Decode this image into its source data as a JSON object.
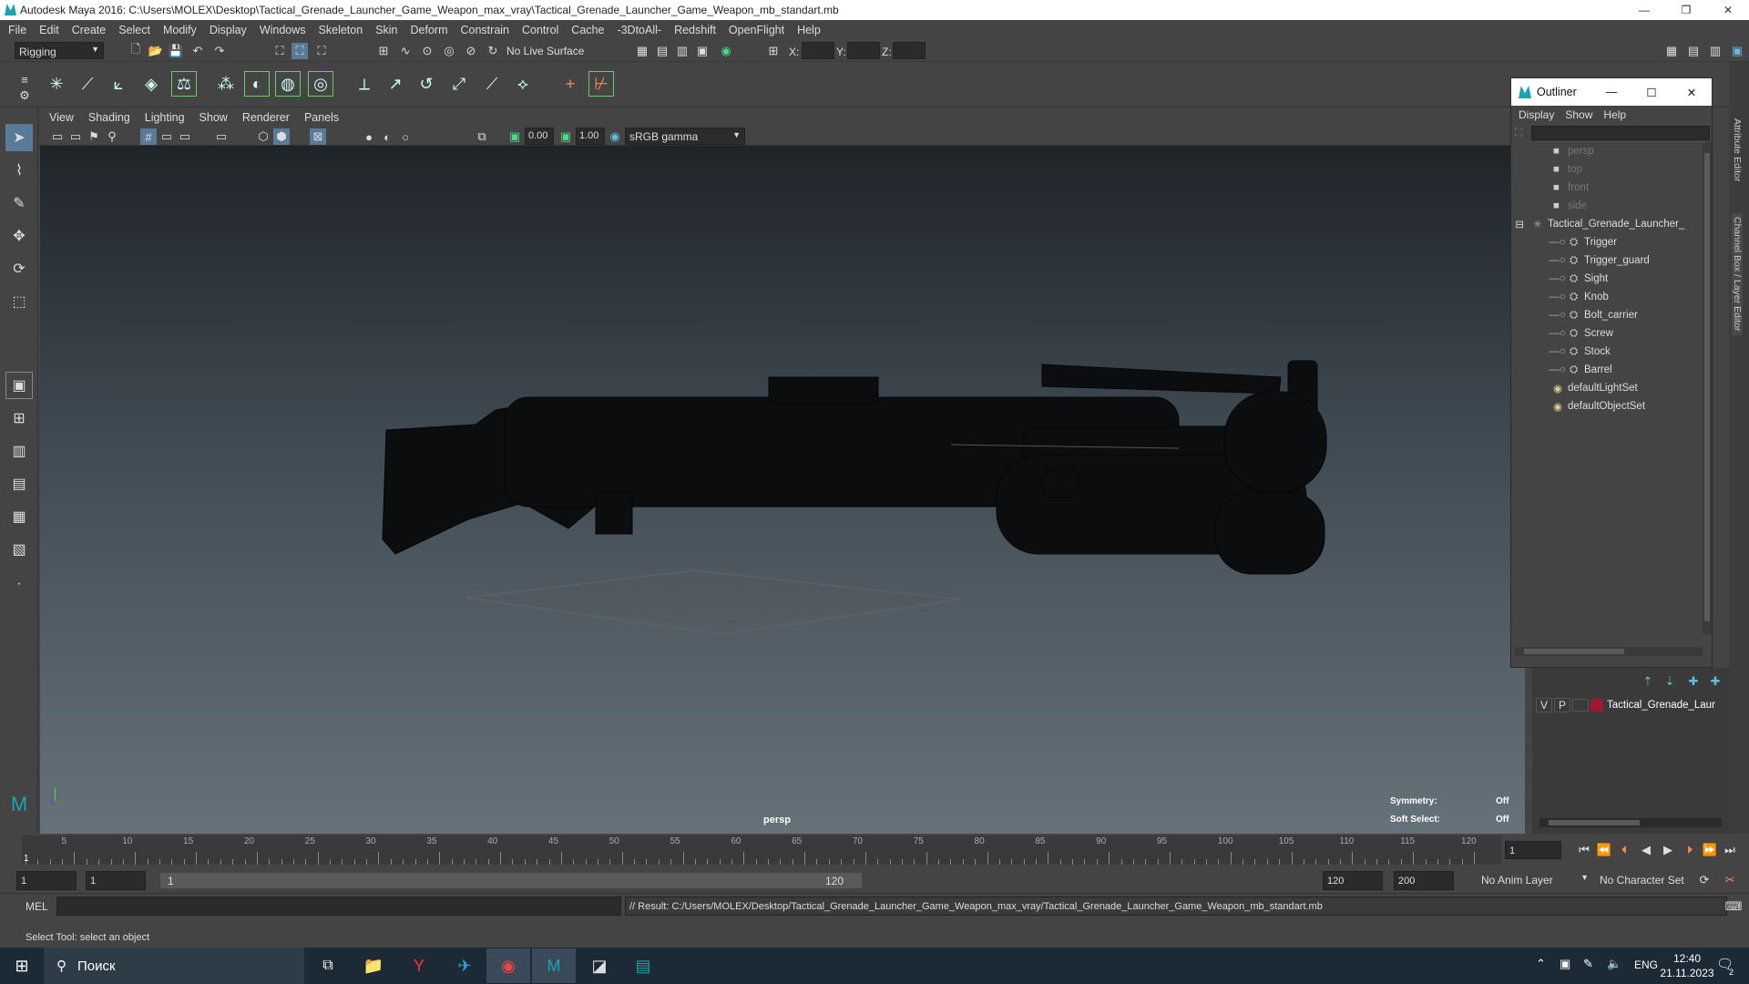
{
  "window": {
    "title": "Autodesk Maya 2016: C:\\Users\\MOLEX\\Desktop\\Tactical_Grenade_Launcher_Game_Weapon_max_vray\\Tactical_Grenade_Launcher_Game_Weapon_mb_standart.mb",
    "minimize": "—",
    "restore": "❐",
    "close": "✕"
  },
  "menubar": [
    "File",
    "Edit",
    "Create",
    "Select",
    "Modify",
    "Display",
    "Windows",
    "Skeleton",
    "Skin",
    "Deform",
    "Constrain",
    "Control",
    "Cache",
    "-3DtoAll-",
    "Redshift",
    "OpenFlight",
    "Help"
  ],
  "status": {
    "mode": "Rigging",
    "live_surface": "No Live Surface",
    "x_label": "X:",
    "y_label": "Y:",
    "z_label": "Z:"
  },
  "panel_menu": [
    "View",
    "Shading",
    "Lighting",
    "Show",
    "Renderer",
    "Panels"
  ],
  "panel_toolbar": {
    "exposure": "0.00",
    "gamma": "1.00",
    "color_space": "sRGB gamma"
  },
  "viewport": {
    "camera_label": "persp",
    "symmetry_label": "Symmetry:",
    "symmetry_value": "Off",
    "soft_select_label": "Soft Select:",
    "soft_select_value": "Off"
  },
  "outliner": {
    "title": "Outliner",
    "menu": [
      "Display",
      "Show",
      "Help"
    ],
    "items": [
      {
        "label": "persp",
        "kind": "camera",
        "indent": 0,
        "dim": true
      },
      {
        "label": "top",
        "kind": "camera",
        "indent": 0,
        "dim": true
      },
      {
        "label": "front",
        "kind": "camera",
        "indent": 0,
        "dim": true
      },
      {
        "label": "side",
        "kind": "camera",
        "indent": 0,
        "dim": true
      },
      {
        "label": "Tactical_Grenade_Launcher_",
        "kind": "group",
        "indent": 0,
        "dim": false
      },
      {
        "label": "Trigger",
        "kind": "mesh",
        "indent": 1,
        "dim": false
      },
      {
        "label": "Trigger_guard",
        "kind": "mesh",
        "indent": 1,
        "dim": false
      },
      {
        "label": "Sight",
        "kind": "mesh",
        "indent": 1,
        "dim": false
      },
      {
        "label": "Knob",
        "kind": "mesh",
        "indent": 1,
        "dim": false
      },
      {
        "label": "Bolt_carrier",
        "kind": "mesh",
        "indent": 1,
        "dim": false
      },
      {
        "label": "Screw",
        "kind": "mesh",
        "indent": 1,
        "dim": false
      },
      {
        "label": "Stock",
        "kind": "mesh",
        "indent": 1,
        "dim": false
      },
      {
        "label": "Barrel",
        "kind": "mesh",
        "indent": 1,
        "dim": false
      },
      {
        "label": "defaultLightSet",
        "kind": "set",
        "indent": 0,
        "dim": false
      },
      {
        "label": "defaultObjectSet",
        "kind": "set",
        "indent": 0,
        "dim": false
      }
    ]
  },
  "side_tabs": [
    "Attribute Editor",
    "Channel Box / Layer Editor"
  ],
  "layer": {
    "v": "V",
    "p": "P",
    "name": "Tactical_Grenade_Laur",
    "color": "#a01830"
  },
  "timeline": {
    "ticks": [
      "5",
      "10",
      "15",
      "20",
      "25",
      "30",
      "35",
      "40",
      "45",
      "50",
      "55",
      "60",
      "65",
      "70",
      "75",
      "80",
      "85",
      "90",
      "95",
      "100",
      "105",
      "110",
      "115",
      "120"
    ],
    "start_marker": "1",
    "current_frame": "1"
  },
  "range": {
    "start": "1",
    "start2": "1",
    "slider_start": "1",
    "slider_end": "120",
    "end": "120",
    "end2": "200",
    "anim_layer": "No Anim Layer",
    "char_set": "No Character Set"
  },
  "cmd": {
    "lang": "MEL",
    "result": "// Result: C:/Users/MOLEX/Desktop/Tactical_Grenade_Launcher_Game_Weapon_max_vray/Tactical_Grenade_Launcher_Game_Weapon_mb_standart.mb"
  },
  "help_line": "Select Tool: select an object",
  "taskbar": {
    "search_placeholder": "Поиск",
    "lang": "ENG",
    "time": "12:40",
    "date": "21.11.2023",
    "notif_count": "2"
  }
}
